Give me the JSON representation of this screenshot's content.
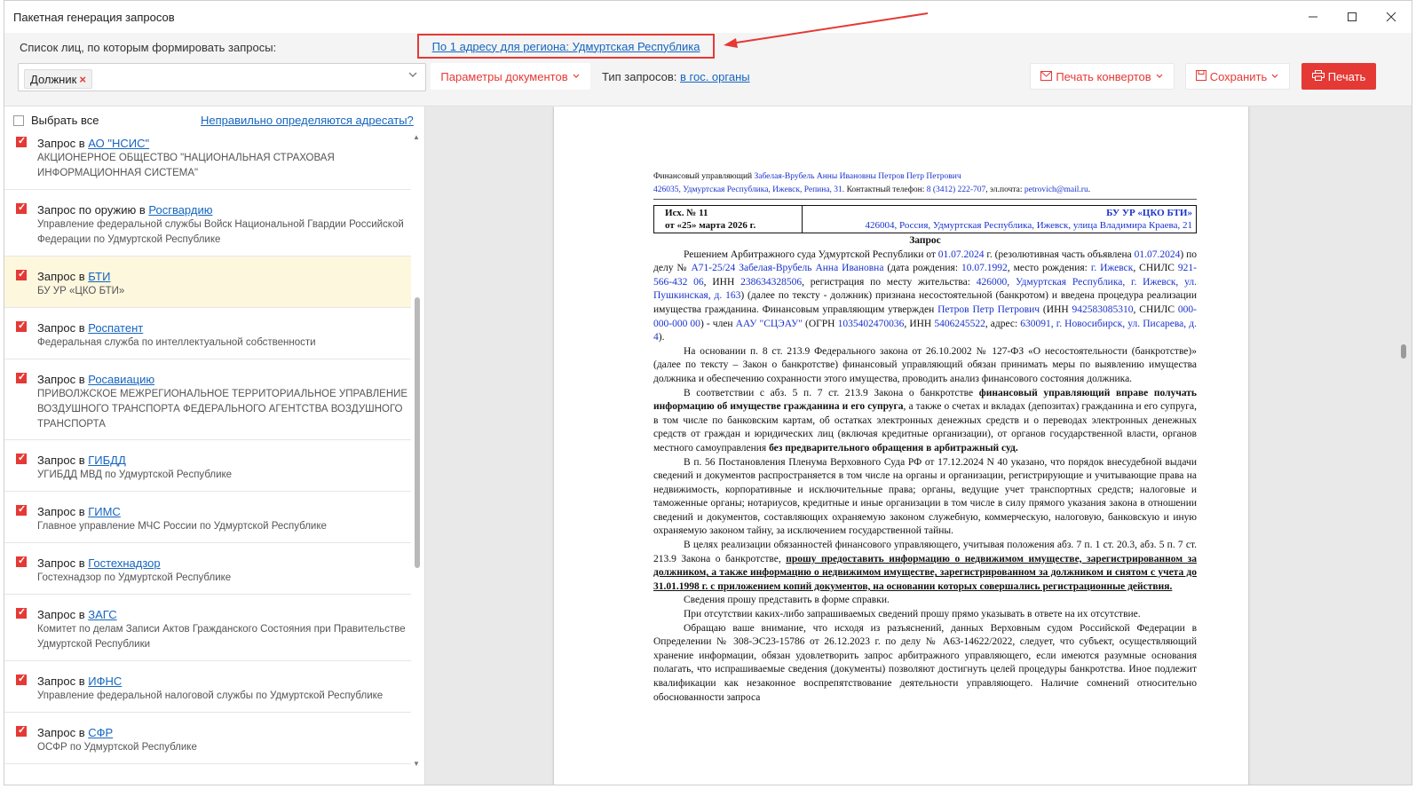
{
  "window": {
    "title": "Пакетная генерация запросов"
  },
  "toolbar": {
    "list_label": "Список лиц, по которым формировать запросы:",
    "addr_link": "По 1 адресу для региона: Удмуртская Республика",
    "debtor_chip": "Должник",
    "doc_params": "Параметры документов",
    "req_type_label": "Тип запросов:",
    "req_type_value": "в гос. органы",
    "print_envelopes": "Печать конвертов",
    "save": "Сохранить",
    "print": "Печать"
  },
  "left": {
    "select_all": "Выбрать все",
    "wrong_addressees": "Неправильно определяются адресаты?",
    "items": [
      {
        "prefix": "Запрос в ",
        "link": "АО \"НСИС\"",
        "desc": "АКЦИОНЕРНОЕ ОБЩЕСТВО \"НАЦИОНАЛЬНАЯ СТРАХОВАЯ ИНФОРМАЦИОННАЯ СИСТЕМА\""
      },
      {
        "prefix": "Запрос по оружию в ",
        "link": "Росгвардию",
        "desc": "Управление федеральной службы Войск Национальной Гвардии Российской Федерации по Удмуртской Республике"
      },
      {
        "prefix": "Запрос в ",
        "link": "БТИ",
        "desc": "БУ УР «ЦКО БТИ»"
      },
      {
        "prefix": "Запрос в ",
        "link": "Роспатент",
        "desc": "Федеральная служба по интеллектуальной собственности"
      },
      {
        "prefix": "Запрос в ",
        "link": "Росавиацию",
        "desc": "ПРИВОЛЖСКОЕ МЕЖРЕГИОНАЛЬНОЕ ТЕРРИТОРИАЛЬНОЕ УПРАВЛЕНИЕ ВОЗДУШНОГО ТРАНСПОРТА ФЕДЕРАЛЬНОГО АГЕНТСТВА ВОЗДУШНОГО ТРАНСПОРТА"
      },
      {
        "prefix": "Запрос в ",
        "link": "ГИБДД",
        "desc": "УГИБДД МВД по Удмуртской Республике"
      },
      {
        "prefix": "Запрос в ",
        "link": "ГИМС",
        "desc": "Главное управление МЧС России по Удмуртской Республике"
      },
      {
        "prefix": "Запрос в ",
        "link": "Гостехнадзор",
        "desc": "Гостехнадзор по Удмуртской Республике"
      },
      {
        "prefix": "Запрос в ",
        "link": "ЗАГС",
        "desc": "Комитет по делам Записи Актов Гражданского Состояния при Правительстве Удмуртской Республики"
      },
      {
        "prefix": "Запрос в ",
        "link": "ИФНС",
        "desc": "Управление федеральной налоговой службы по Удмуртской Республике"
      },
      {
        "prefix": "Запрос в ",
        "link": "СФР",
        "desc": "ОСФР по Удмуртской Республике"
      }
    ]
  },
  "doc": {
    "h1a": "Финансовый управляющий ",
    "h1b": "Забелая-Врубель Анны Ивановны Петров Петр Петрович",
    "h2a": "426035, Удмуртская Республика, Ижевск, Репина, 31.",
    "h2b": " Контактный телефон: ",
    "h2c": "8 (3412) 222-707",
    "h2d": ", эл.почта: ",
    "h2e": "petrovich@mail.ru",
    "h2f": ".",
    "outno": "Исх. № 11",
    "outdate": "от «25» марта 2026 г.",
    "recipient": "БУ УР «ЦКО БТИ»",
    "recipient_addr": "426004, Россия, Удмуртская Республика, Ижевск, улица Владимира Краева, 21",
    "heading": "Запрос",
    "p1": {
      "a": "Решением Арбитражного суда Удмуртской Республики от ",
      "b": "01.07.2024",
      "c": " г. (резолютивная часть объявлена ",
      "d": "01.07.2024",
      "e": ") по делу № ",
      "f": "А71-25/24 Забелая-Врубель Анна Ивановна",
      "g": " (дата рождения: ",
      "h": "10.07.1992",
      "i": ", место рождения: ",
      "j": "г. Ижевск",
      "k": ", СНИЛС ",
      "l": "921-566-432 06",
      "m": ", ИНН ",
      "n": "238634328506",
      "o": ", регистрация по месту жительства: ",
      "p": "426000, Удмуртская Республика, г. Ижевск, ул. Пушкинская, д. 163",
      "q": ") (далее по тексту - должник) признана несостоятельной (банкротом) и введена процедура реализации имущества гражданина. Финансовым управляющим утвержден ",
      "r": "Петров Петр Петрович",
      "s": " (ИНН ",
      "t": "942583085310",
      "u": ", СНИЛС ",
      "v": "000-000-000 00",
      "w": ") - член ",
      "x": "ААУ \"СЦЭАУ\"",
      "y": " (ОГРН ",
      "z": "1035402470036",
      "aa": ", ИНН ",
      "ab": "5406245522",
      "ac": ", адрес: ",
      "ad": "630091, г. Новосибирск, ул. Писарева, д. 4",
      "ae": ")."
    },
    "p2": "На основании п. 8 ст. 213.9 Федерального закона от 26.10.2002 № 127-ФЗ «О несостоятельности (банкротстве)» (далее по тексту – Закон о банкротстве) финансовый управляющий обязан принимать меры по выявлению имущества должника и обеспечению сохранности этого имущества, проводить анализ финансового состояния должника.",
    "p3": {
      "a": "В соответствии с абз. 5 п. 7 ст. 213.9 Закона о банкротстве ",
      "b": "финансовый управляющий вправе получать информацию об имуществе гражданина и его супруга",
      "c": ", а также о счетах и вкладах (депозитах) гражданина и его супруга, в том числе по банковским картам, об остатках электронных денежных средств и о переводах электронных денежных средств от граждан и юридических лиц (включая кредитные организации), от органов государственной власти, органов местного самоуправления ",
      "d": "без предварительного обращения в арбитражный суд."
    },
    "p4": "В п. 56 Постановления Пленума Верховного Суда РФ от 17.12.2024 N 40 указано, что порядок внесудебной выдачи сведений и документов распространяется в том числе на органы и организации, регистрирующие и учитывающие права на недвижимость, корпоративные и исключительные права; органы, ведущие учет транспортных средств; налоговые и таможенные органы; нотариусов, кредитные и иные организации в том числе в силу прямого указания закона в отношении сведений и документов, составляющих охраняемую законом служебную, коммерческую, налоговую, банковскую и иную охраняемую законом тайну, за исключением государственной тайны.",
    "p5": {
      "a": "В целях реализации обязанностей финансового управляющего, учитывая положения абз. 7 п. 1 ст. 20.3, абз. 5 п. 7 ст. 213.9 Закона о банкротстве, ",
      "b": "прошу предоставить информацию о недвижимом имуществе, зарегистрированном за должником, а также информацию о недвижимом имуществе, зарегистрированном за должником и снятом с учета до 31.01.1998 г. с приложением копий документов, на основании которых совершались регистрационные действия."
    },
    "p6": "Сведения прошу представить в форме справки.",
    "p7": "При отсутствии каких-либо запрашиваемых сведений прошу прямо указывать в ответе на их отсутствие.",
    "p8": "Обращаю ваше внимание, что исходя из разъяснений, данных Верховным судом Российской Федерации в Определении № 308-ЭС23-15786 от 26.12.2023 г. по делу № А63-14622/2022, следует, что субъект, осуществляющий хранение информации, обязан удовлетворить запрос арбитражного управляющего, если имеются разумные основания полагать, что испрашиваемые сведения (документы) позволяют достигнуть целей процедуры банкротства. Иное подлежит квалификации как незаконное воспрепятствование деятельности управляющего. Наличие сомнений относительно обоснованности запроса"
  },
  "colors": {
    "accent": "#e53935",
    "link": "#1565c0",
    "doc_blue": "#1a33cc",
    "selected_row": "#fdf7de"
  }
}
